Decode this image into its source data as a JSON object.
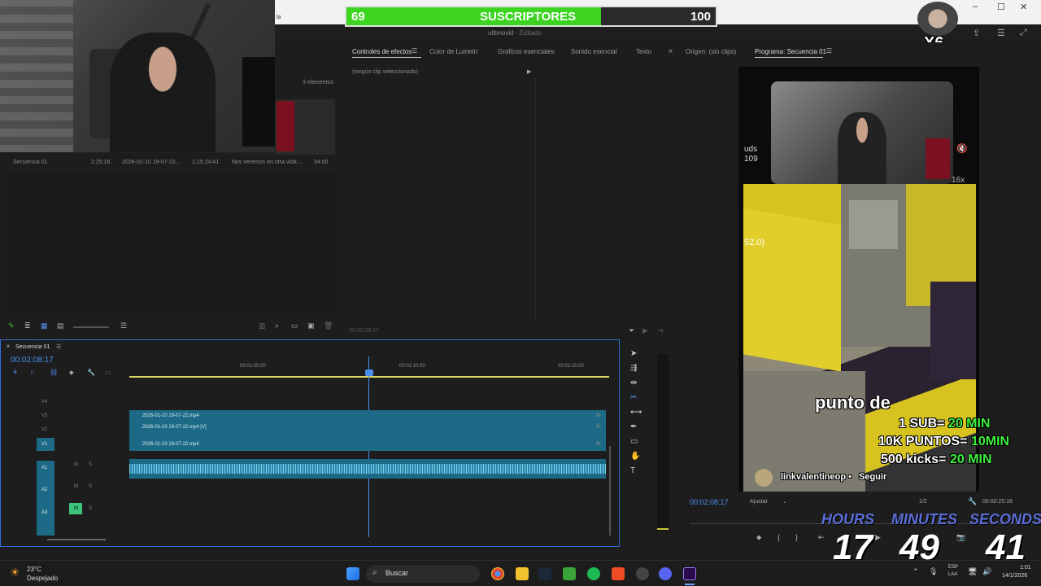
{
  "subscribers": {
    "current": "69",
    "label": "SUSCRIPTORES",
    "goal": "100",
    "progress_fraction": 0.69
  },
  "window": {
    "title": "ulitmovid",
    "title_suffix": " - Editado"
  },
  "project_panel": {
    "items_count": "3 elementos",
    "row": {
      "name": "Secuencia 01",
      "duration": "2:25:16",
      "clip": "2026-01-10 19-07-22...",
      "time2": "1:15:24:41",
      "desc": "Nos veremos en otra vida ...",
      "fps": "34:00"
    }
  },
  "effects_panel": {
    "tabs": [
      "Controles de efectos",
      "Color de Lumetri",
      "Gráficos esenciales",
      "Sonido esencial",
      "Texto"
    ],
    "empty_text": "(ningún clip seleccionado)",
    "timecode": "00:02:08:17"
  },
  "program_panel": {
    "source_tab": "Origen: (sin clips)",
    "program_tab": "Programa: Secuencia 01",
    "timecode": "00:02:08:17",
    "fit": "Ajustar",
    "ratio": "1/2",
    "duration": "00:02:25:16"
  },
  "overlay": {
    "caption": "punto de",
    "goals": [
      {
        "left": "1 SUB=",
        "right": "20 MIN"
      },
      {
        "left": "10K PUNTOS=",
        "right": "10MIN"
      },
      {
        "left": "500 kicks=",
        "right": "20 MIN"
      }
    ],
    "channel": "linkvalentineop",
    "follow": "Seguir",
    "hud_left": "uds",
    "hud_left2": "109",
    "hud_val": "52.0)",
    "hud_zoom": "16x",
    "badge": "X6"
  },
  "timer": {
    "labels": [
      "HOURS",
      "MINUTES",
      "SECONDS"
    ],
    "values": [
      "17",
      "49",
      "41"
    ]
  },
  "timeline": {
    "tab": "Secuencia 01",
    "timecode": "00:02:08:17",
    "ruler": [
      "00:02:05:00",
      "00:02:10:00",
      "00:02:15:00"
    ],
    "tracks_video": [
      "V4",
      "V3",
      "V2",
      "V1"
    ],
    "tracks_audio": [
      "A1",
      "A2",
      "A3"
    ],
    "clips": [
      "2026-01-10 19-07-22.mp4",
      "2026-01-10 19-07-22.mp4 [V]",
      "2026-01-10 19-07-22.mp4"
    ],
    "fx": "fx",
    "m": "M",
    "s": "S"
  },
  "taskbar": {
    "temp": "23°C",
    "weather": "Despejado",
    "search": "Buscar",
    "lang1": "ESP",
    "lang2": "LAA",
    "time": "1:01",
    "date": "14/1/2026"
  }
}
